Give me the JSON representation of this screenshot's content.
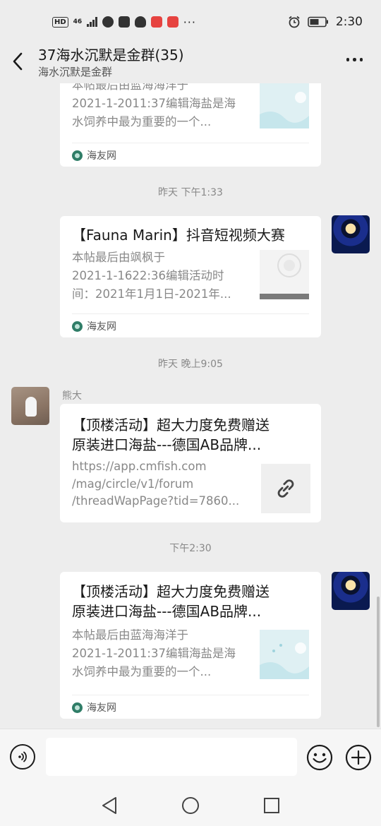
{
  "status_bar": {
    "hd": "HD",
    "network": "46",
    "time": "2:30",
    "more": "···"
  },
  "header": {
    "title": "37海水沉默是金群(35)",
    "subtitle": "海水沉默是金群"
  },
  "messages": [
    {
      "title": "",
      "desc_lines": [
        "本帖最后由蓝海海洋于",
        "2021-1-2011:37编辑海盐是海",
        "水饲养中最为重要的一个..."
      ],
      "source": "海友网"
    },
    {
      "timestamp": "昨天 下午1:33",
      "title": "【Fauna Marin】抖音短视频大赛",
      "desc_lines": [
        "本帖最后由飒枫于",
        "2021-1-1622:36编辑活动时",
        "间：2021年1月1日-2021年..."
      ],
      "source": "海友网"
    },
    {
      "timestamp": "昨天 晚上9:05",
      "sender": "熊大",
      "title_lines": [
        "【顶楼活动】超大力度免费赠送",
        "原装进口海盐---德国AB品牌..."
      ],
      "url_lines": [
        "https://app.cmfish.com",
        "/mag/circle/v1/forum",
        "/threadWapPage?tid=7860..."
      ]
    },
    {
      "timestamp": "下午2:30",
      "title_lines": [
        "【顶楼活动】超大力度免费赠送",
        "原装进口海盐---德国AB品牌..."
      ],
      "desc_lines": [
        "本帖最后由蓝海海洋于",
        "2021-1-2011:37编辑海盐是海",
        "水饲养中最为重要的一个..."
      ],
      "source": "海友网"
    }
  ],
  "input": {
    "value": ""
  },
  "colors": {
    "background": "#ededed",
    "card": "#ffffff",
    "muted_text": "#888888"
  }
}
